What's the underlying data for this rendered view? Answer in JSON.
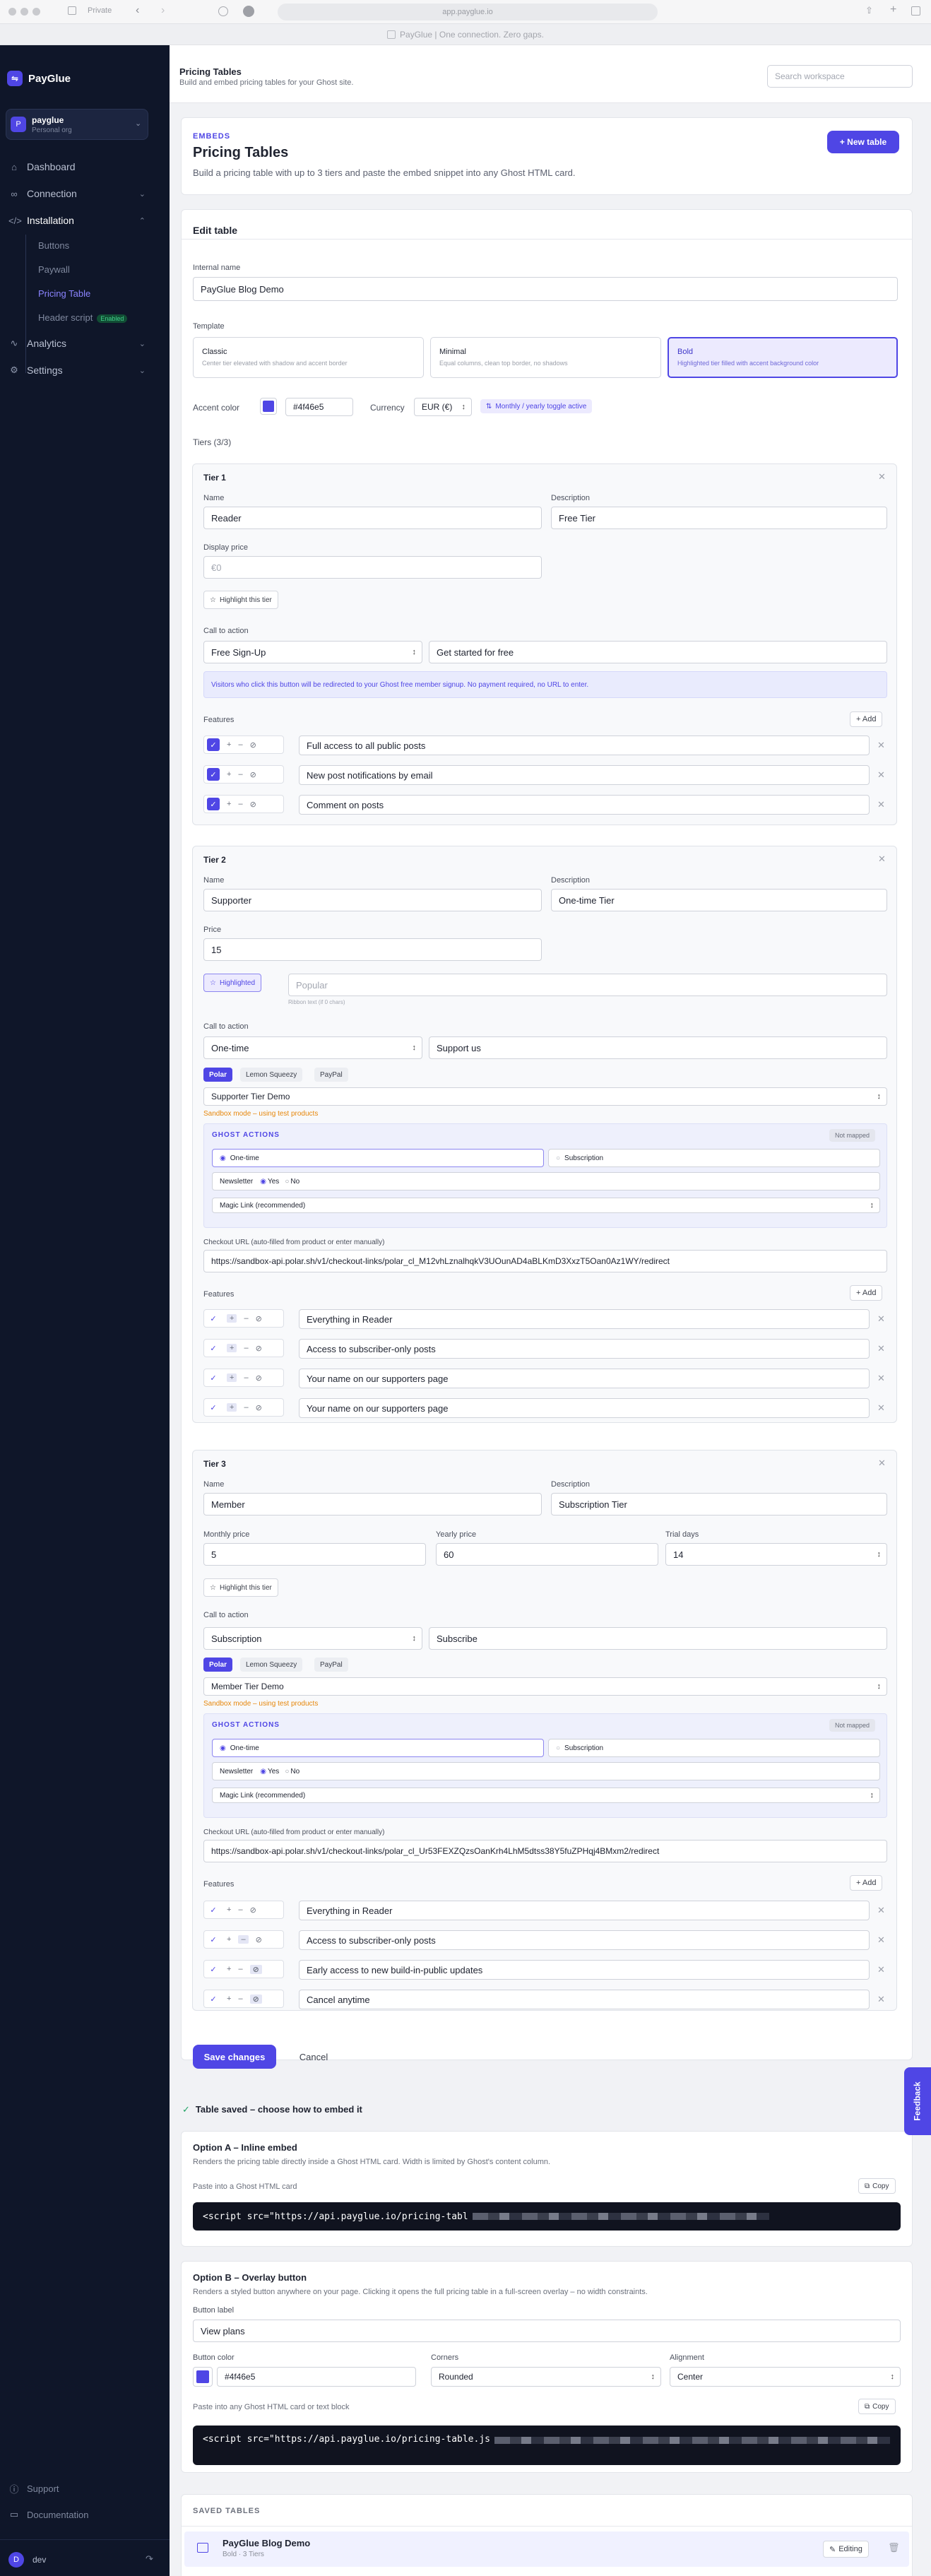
{
  "browser": {
    "url": "app.payglue.io",
    "tab": "Private",
    "banner": "PayGlue | One connection. Zero gaps."
  },
  "brand": {
    "name": "PayGlue",
    "accent": "#4f46e5"
  },
  "workspace": {
    "name": "payglue",
    "sub": "Personal org"
  },
  "nav": {
    "dashboard": "Dashboard",
    "connection": "Connection",
    "installation": "Installation",
    "buttons": "Buttons",
    "paywall": "Paywall",
    "pricing_table": "Pricing Table",
    "header_script": "Header script",
    "header_badge": "Enabled",
    "analytics": "Analytics",
    "settings": "Settings",
    "support": "Support",
    "documentation": "Documentation",
    "user": "dev",
    "user_initial": "D"
  },
  "topbar": {
    "title": "Pricing Tables",
    "subtitle": "Build and embed pricing tables for your Ghost site.",
    "search_placeholder": "Search workspace"
  },
  "hero": {
    "eyebrow": "EMBEDS",
    "title": "Pricing Tables",
    "desc": "Build a pricing table with up to 3 tiers and paste the embed snippet into any Ghost HTML card.",
    "new_button": "+ New table"
  },
  "edit": {
    "title": "Edit table",
    "internal_name_label": "Internal name",
    "internal_name": "PayGlue Blog Demo",
    "template_label": "Template",
    "templates": [
      {
        "name": "Classic",
        "desc": "Center tier elevated with shadow and accent border"
      },
      {
        "name": "Minimal",
        "desc": "Equal columns, clean top border, no shadows"
      },
      {
        "name": "Bold",
        "desc": "Highlighted tier filled with accent background color"
      }
    ],
    "accent_label": "Accent color",
    "accent_value": "#4f46e5",
    "currency_label": "Currency",
    "currency_value": "EUR (€)",
    "toggle_note": "Monthly / yearly toggle active",
    "tiers_label": "Tiers (3/3)"
  },
  "common": {
    "name": "Name",
    "description": "Description",
    "display_price": "Display price",
    "price": "Price",
    "monthly_price": "Monthly price",
    "yearly_price": "Yearly price",
    "trial_days": "Trial days",
    "cta": "Call to action",
    "features": "Features",
    "add": "+ Add",
    "highlight": "Highlight this tier",
    "highlighted": "Highlighted",
    "popular_ph": "Popular",
    "ribbon_note": "Ribbon text (if 0 chars)",
    "sandbox": "Sandbox mode – using test products",
    "ghost_actions": "GHOST ACTIONS",
    "not_mapped": "Not mapped",
    "one_time": "One-time",
    "subscription": "Subscription",
    "newsletter": "Newsletter",
    "yes": "Yes",
    "no": "No",
    "magic_link": "Magic Link (recommended)",
    "checkout_label": "Checkout URL (auto-filled from product or enter manually)",
    "providers": [
      "Polar",
      "Lemon Squeezy",
      "PayPal"
    ]
  },
  "tiers": [
    {
      "title": "Tier 1",
      "name": "Reader",
      "description": "Free Tier",
      "price_ph": "€0",
      "cta_type": "Free Sign-Up",
      "cta_text": "Get started for free",
      "notice": "Visitors who click this button will be redirected to your Ghost free member signup. No payment required, no URL to enter.",
      "features": [
        "Full access to all public posts",
        "New post notifications by email",
        "Comment on posts"
      ]
    },
    {
      "title": "Tier 2",
      "name": "Supporter",
      "description": "One-time Tier",
      "price": "15",
      "cta_type": "One-time",
      "cta_text": "Support us",
      "product": "Supporter Tier Demo",
      "checkout": "https://sandbox-api.polar.sh/v1/checkout-links/polar_cl_M12vhLznalhqkV3UOunAD4aBLKmD3XxzT5Oan0Az1WY/redirect",
      "features": [
        "Everything in Reader",
        "Access to subscriber-only posts",
        "Your name on our supporters page",
        "Your name on our supporters page"
      ]
    },
    {
      "title": "Tier 3",
      "name": "Member",
      "description": "Subscription Tier",
      "monthly": "5",
      "yearly": "60",
      "trial": "14",
      "cta_type": "Subscription",
      "cta_text": "Subscribe",
      "product": "Member Tier Demo",
      "checkout": "https://sandbox-api.polar.sh/v1/checkout-links/polar_cl_Ur53FEXZQzsOanKrh4LhM5dtss38Y5fuZPHqj4BMxm2/redirect",
      "features": [
        "Everything in Reader",
        "Access to subscriber-only posts",
        "Early access to new build-in-public updates",
        "Cancel anytime"
      ]
    }
  ],
  "actions": {
    "save": "Save changes",
    "cancel": "Cancel",
    "saved": "Table saved – choose how to embed it"
  },
  "option_a": {
    "title": "Option A – Inline embed",
    "desc": "Renders the pricing table directly inside a Ghost HTML card. Width is limited by Ghost's content column.",
    "paste": "Paste into a Ghost HTML card",
    "copy": "Copy",
    "code": "<script src=\"https://api.payglue.io/pricing-tabl"
  },
  "option_b": {
    "title": "Option B – Overlay button",
    "desc": "Renders a styled button anywhere on your page. Clicking it opens the full pricing table in a full-screen overlay – no width constraints.",
    "button_label": "Button label",
    "button_value": "View plans",
    "button_color": "Button color",
    "color_value": "#4f46e5",
    "corners_label": "Corners",
    "corners_value": "Rounded",
    "alignment_label": "Alignment",
    "alignment_value": "Center",
    "paste": "Paste into any Ghost HTML card or text block",
    "copy": "Copy",
    "code": "<script src=\"https://api.payglue.io/pricing-table.js"
  },
  "saved_tables": {
    "title": "SAVED TABLES",
    "name": "PayGlue Blog Demo",
    "meta": "Bold · 3 Tiers",
    "edit": "Editing"
  },
  "feedback": "Feedback"
}
